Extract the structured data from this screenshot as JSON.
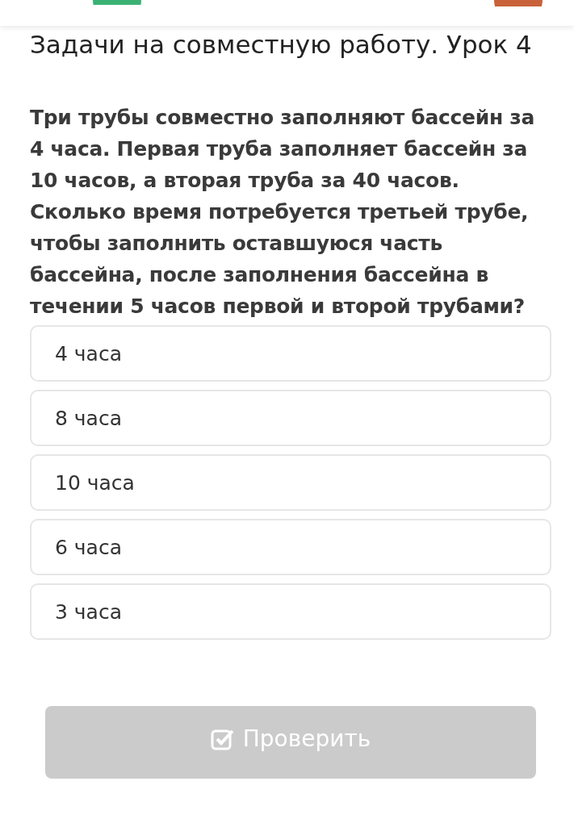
{
  "title": "Задачи на совместную работу. Урок 4",
  "question": "Три трубы совместно заполняют бассейн за 4 часа. Первая труба заполняет бассейн за 10 часов, а вторая труба за 40 часов. Сколько время потребуется третьей трубе, чтобы заполнить оставшуюся часть бассейна, после заполнения бассейна в течении 5 часов первой и второй трубами?",
  "options": [
    {
      "label": "4 часа",
      "selected": false
    },
    {
      "label": "8 часа",
      "selected": false
    },
    {
      "label": "10 часа",
      "selected": false
    },
    {
      "label": "6 часа",
      "selected": false
    },
    {
      "label": "3 часа",
      "selected": false
    }
  ],
  "check_button": {
    "label": "Проверить",
    "disabled": true
  }
}
